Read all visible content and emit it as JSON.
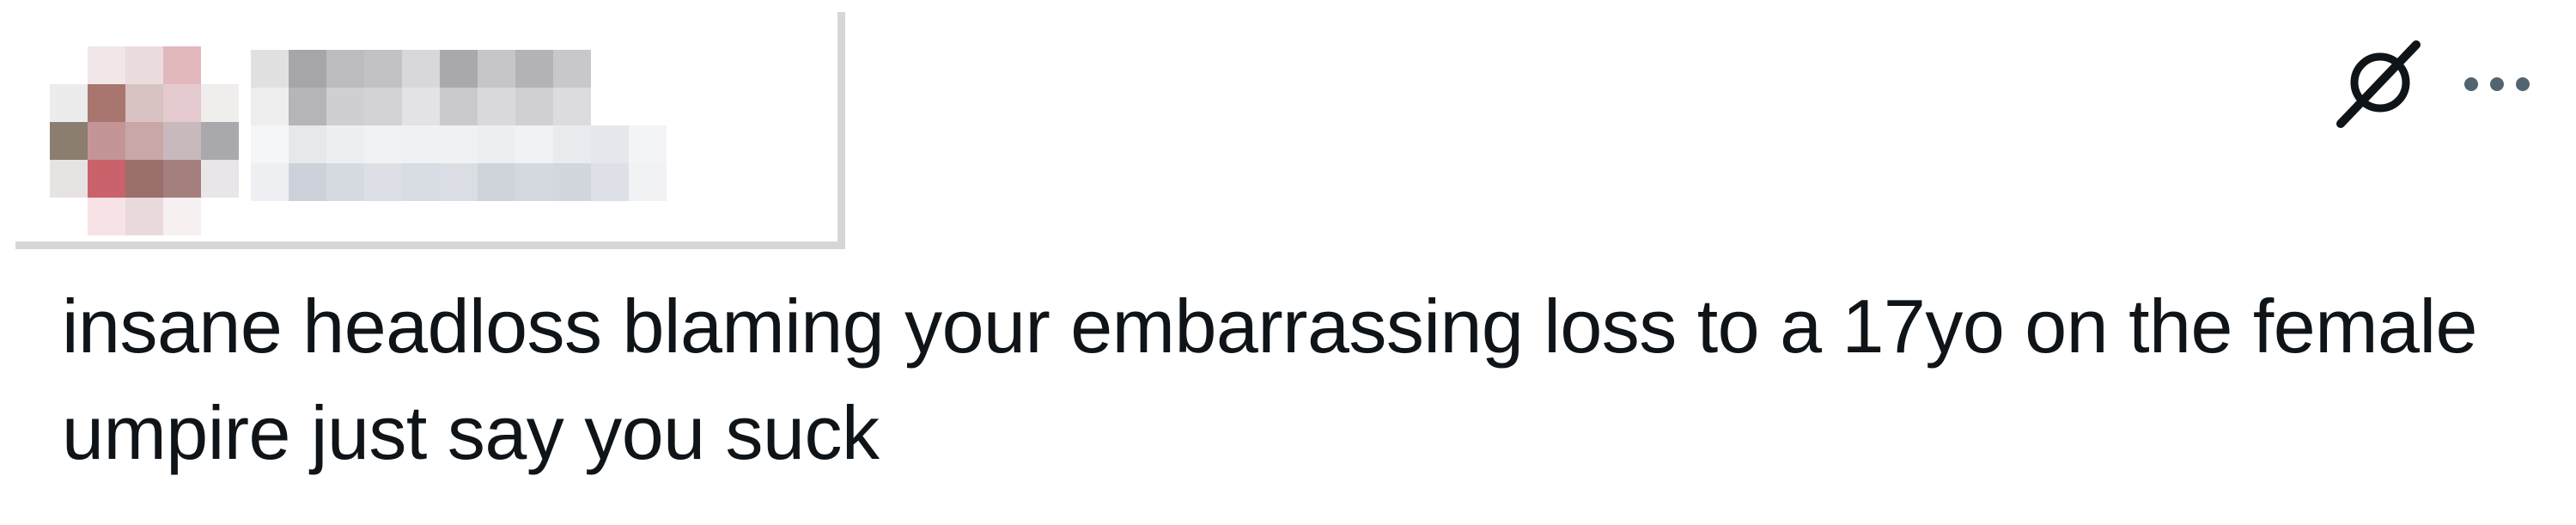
{
  "post": {
    "text": "insane headloss blaming your embarrassing loss to a 17yo on the female umpire just say you suck",
    "author_redacted": true
  },
  "actions": {
    "grok_icon": "grok-icon",
    "more_icon": "more-horizontal-icon"
  },
  "colors": {
    "text": "#0f1419",
    "icon_muted": "#536471",
    "redaction_border": "#d6d6d6"
  }
}
